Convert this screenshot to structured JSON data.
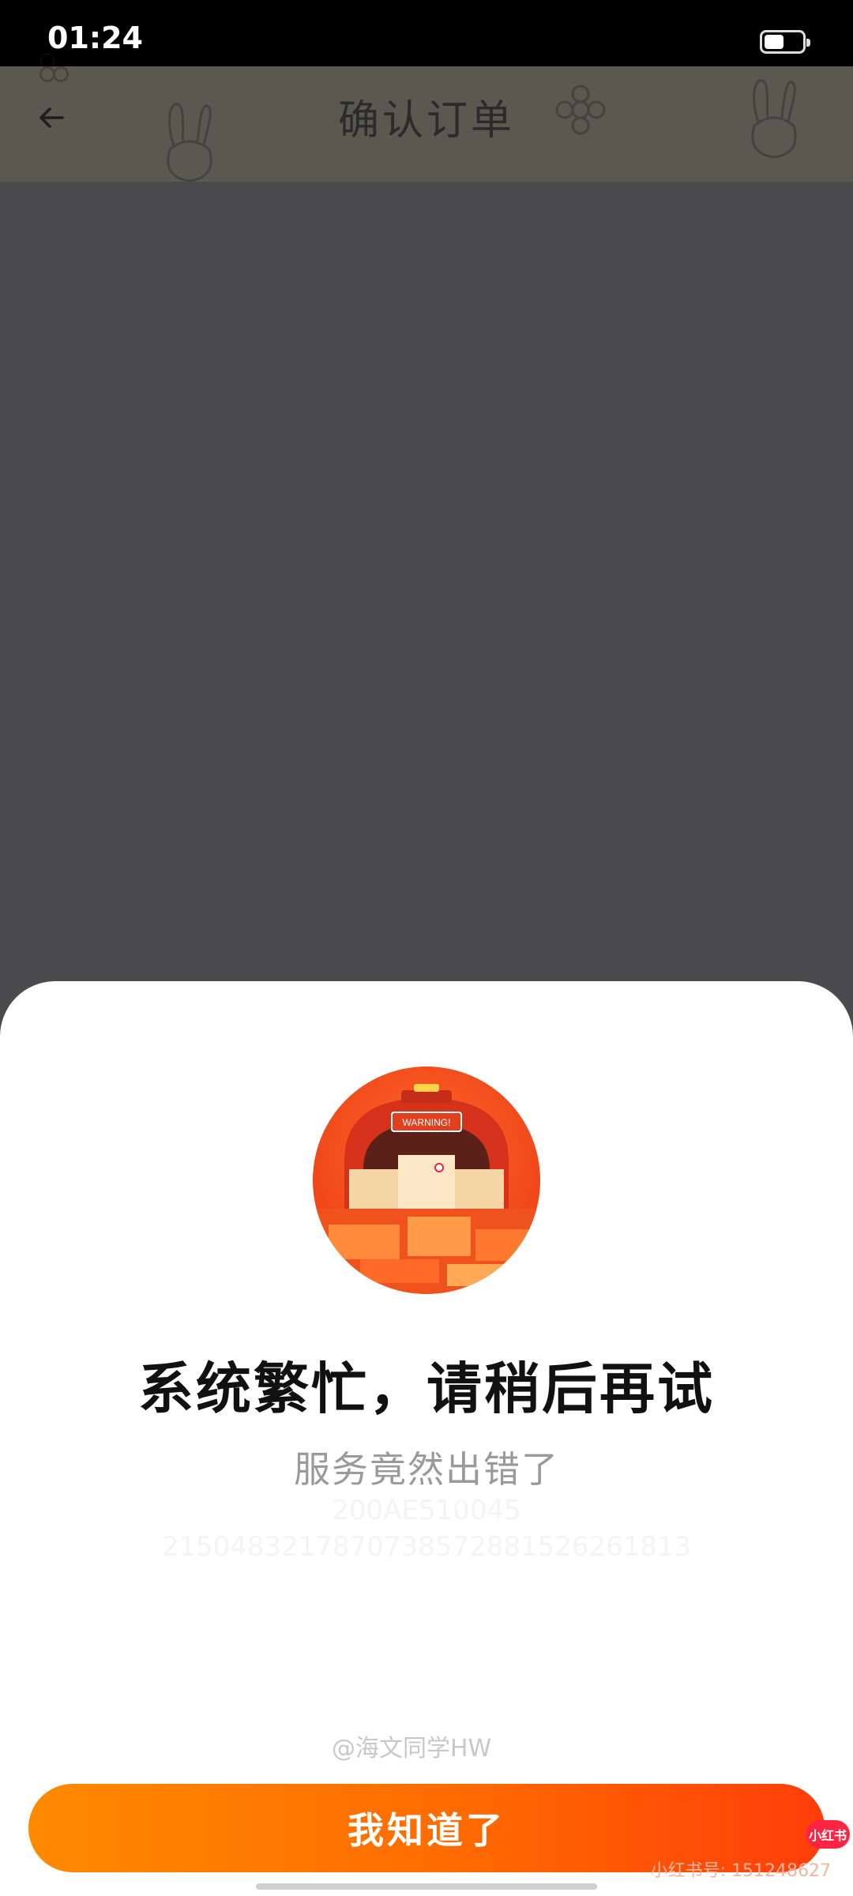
{
  "status_bar": {
    "time": "01:24"
  },
  "header": {
    "title": "确认订单"
  },
  "dialog": {
    "title": "系统繁忙，请稍后再试",
    "subtitle": "服务竟然出错了",
    "code_line_1": "200AE510045",
    "code_line_2": "2150483217870738572881526261813",
    "illustration_text": "WARNING!",
    "confirm_label": "我知道了"
  },
  "watermarks": {
    "weibo": "@海文同学HW",
    "xhs_badge": "小红书",
    "xhs_id": "小红书号: 151248627"
  },
  "colors": {
    "accent_start": "#ff8a00",
    "accent_end": "#ff3e0a",
    "overlay": "#4b4b4d",
    "sheet": "#ffffff"
  },
  "icons": [
    "back-arrow-icon",
    "battery-icon",
    "warning-truck-illustration"
  ]
}
